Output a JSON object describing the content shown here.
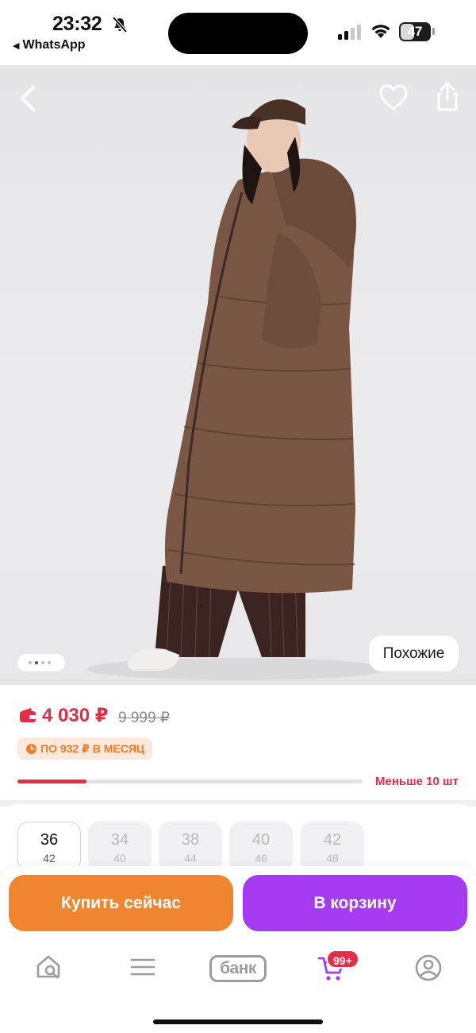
{
  "status_bar": {
    "time": "23:32",
    "back_app_label": "WhatsApp",
    "battery_level": "47",
    "icons": [
      "bell-slash-icon",
      "signal-icon",
      "wifi-icon",
      "battery-icon"
    ]
  },
  "product_image": {
    "slide_index": 2,
    "slide_count": 4,
    "similar_label": "Похожие",
    "icons": [
      "chevron-left-icon",
      "heart-icon",
      "share-icon"
    ]
  },
  "price": {
    "current": "4 030 ₽",
    "old": "9 999 ₽",
    "installment": "ПО 932 ₽ В МЕСЯЦ",
    "stock_label": "Меньше 10 шт",
    "stock_fraction": 0.2,
    "accent_color": "#e52d48",
    "installment_color": "#f07c2a"
  },
  "sizes": [
    {
      "eu": "36",
      "ru": "42",
      "selected": true
    },
    {
      "eu": "34",
      "ru": "40",
      "selected": false
    },
    {
      "eu": "38",
      "ru": "44",
      "selected": false
    },
    {
      "eu": "40",
      "ru": "46",
      "selected": false
    },
    {
      "eu": "42",
      "ru": "48",
      "selected": false
    }
  ],
  "actions": {
    "buy_now": "Купить сейчас",
    "add_to_cart": "В корзину",
    "buy_color": "#f08530",
    "cart_color": "#a53bf0"
  },
  "bottom_nav": {
    "bank_label": "банк",
    "cart_count": "99+",
    "icons": [
      "home-search-icon",
      "menu-icon",
      "bank-icon",
      "cart-icon",
      "profile-icon"
    ]
  }
}
